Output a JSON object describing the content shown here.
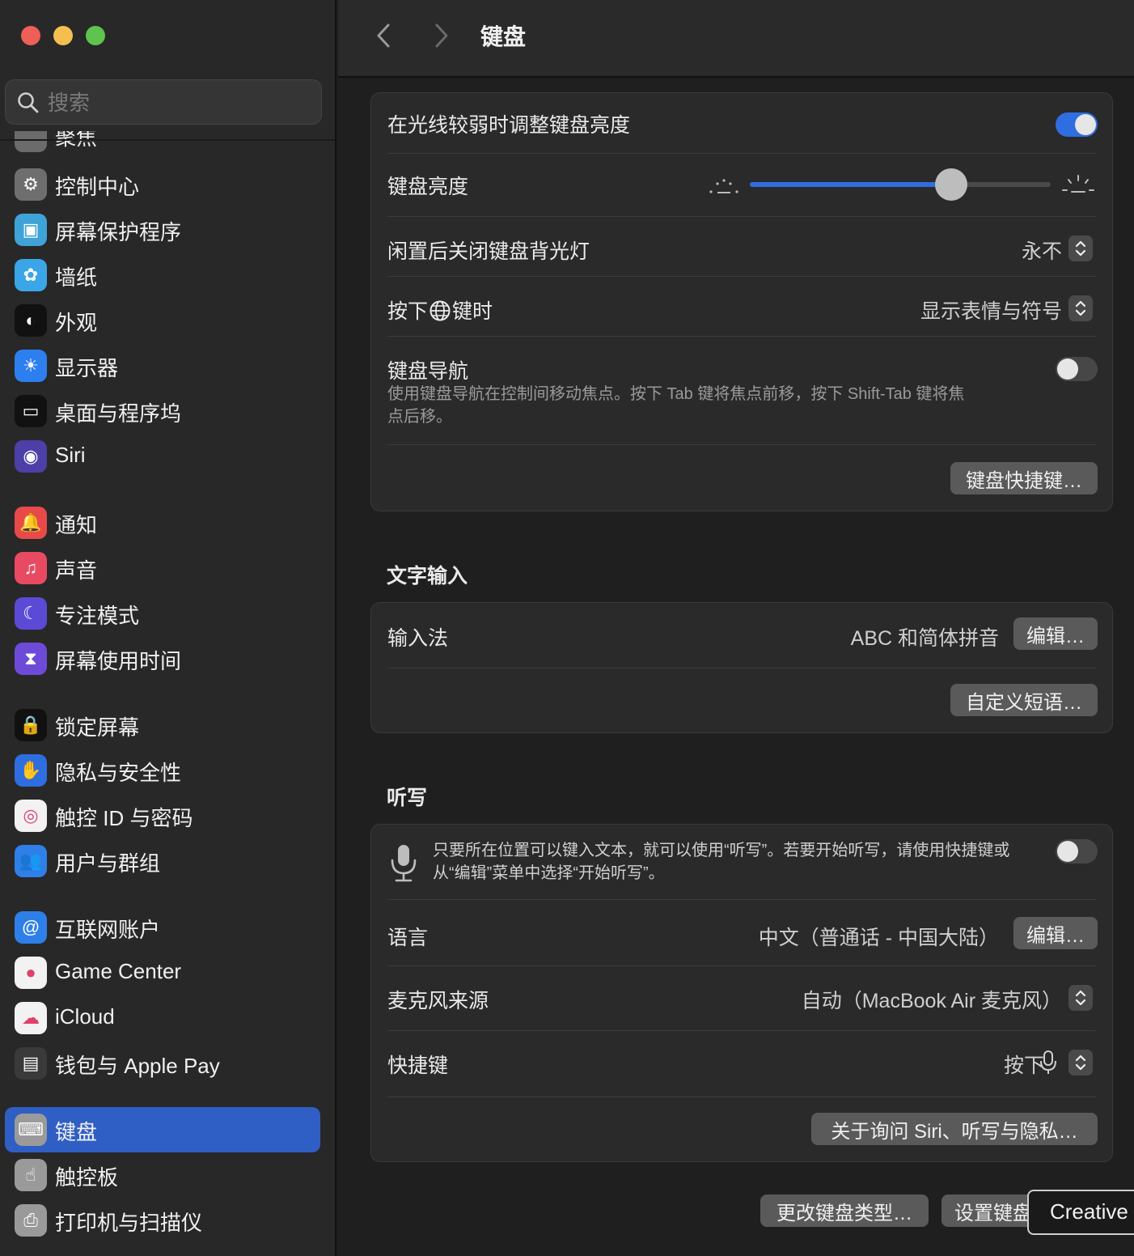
{
  "window": {
    "title": "键盘"
  },
  "colors": {
    "accent": "#2f6ee0",
    "sidebar_active": "#2f5fc4",
    "close": "#ed5f57",
    "minimize": "#f5bf4f",
    "zoom": "#5ec44d"
  },
  "search": {
    "placeholder": "搜索"
  },
  "sidebar": {
    "partial_label": "聚焦",
    "items": [
      {
        "label": "控制中心",
        "icon": "control-center-icon"
      },
      {
        "label": "屏幕保护程序",
        "icon": "screensaver-icon"
      },
      {
        "label": "墙纸",
        "icon": "wallpaper-icon"
      },
      {
        "label": "外观",
        "icon": "appearance-icon"
      },
      {
        "label": "显示器",
        "icon": "displays-icon"
      },
      {
        "label": "桌面与程序坞",
        "icon": "dock-icon"
      },
      {
        "label": "Siri",
        "icon": "siri-icon"
      },
      {
        "label": "通知",
        "icon": "notifications-icon"
      },
      {
        "label": "声音",
        "icon": "sound-icon"
      },
      {
        "label": "专注模式",
        "icon": "focus-icon"
      },
      {
        "label": "屏幕使用时间",
        "icon": "screen-time-icon"
      },
      {
        "label": "锁定屏幕",
        "icon": "lock-screen-icon"
      },
      {
        "label": "隐私与安全性",
        "icon": "privacy-icon"
      },
      {
        "label": "触控 ID 与密码",
        "icon": "touch-id-icon"
      },
      {
        "label": "用户与群组",
        "icon": "users-icon"
      },
      {
        "label": "互联网账户",
        "icon": "internet-accounts-icon"
      },
      {
        "label": "Game Center",
        "icon": "game-center-icon"
      },
      {
        "label": "iCloud",
        "icon": "icloud-icon"
      },
      {
        "label": "钱包与 Apple Pay",
        "icon": "wallet-icon"
      },
      {
        "label": "键盘",
        "icon": "keyboard-icon"
      },
      {
        "label": "触控板",
        "icon": "trackpad-icon"
      },
      {
        "label": "打印机与扫描仪",
        "icon": "printer-icon"
      }
    ]
  },
  "keyboard": {
    "adjust_brightness_label": "在光线较弱时调整键盘亮度",
    "adjust_brightness_on": true,
    "brightness_label": "键盘亮度",
    "brightness_level": 0.67,
    "backlight_off_label": "闲置后关闭键盘背光灯",
    "backlight_off_value": "永不",
    "press_key_label_pre": "按下",
    "press_key_label_post": "键时",
    "press_key_value": "显示表情与符号",
    "nav_label": "键盘导航",
    "nav_desc": "使用键盘导航在控制间移动焦点。按下 Tab 键将焦点前移，按下 Shift-Tab 键将焦点后移。",
    "nav_on": false,
    "shortcuts_button": "键盘快捷键…"
  },
  "text_input": {
    "title": "文字输入",
    "input_label": "输入法",
    "input_value": "ABC 和简体拼音",
    "edit_button": "编辑…",
    "replacements_button": "自定义短语…"
  },
  "dictation": {
    "title": "听写",
    "desc": "只要所在位置可以键入文本，就可以使用“听写”。若要开始听写，请使用快捷键或从“编辑”菜单中选择“开始听写”。",
    "on": false,
    "language_label": "语言",
    "language_value": "中文（普通话 - 中国大陆）",
    "edit_button": "编辑…",
    "mic_label": "麦克风来源",
    "mic_value": "自动（MacBook Air 麦克风）",
    "shortcut_label": "快捷键",
    "shortcut_value": "按下",
    "privacy_button": "关于询问 Siri、听写与隐私…"
  },
  "footer": {
    "change_type_button": "更改键盘类型…",
    "setup_button": "设置键盘…",
    "tooltip": "Creative"
  }
}
